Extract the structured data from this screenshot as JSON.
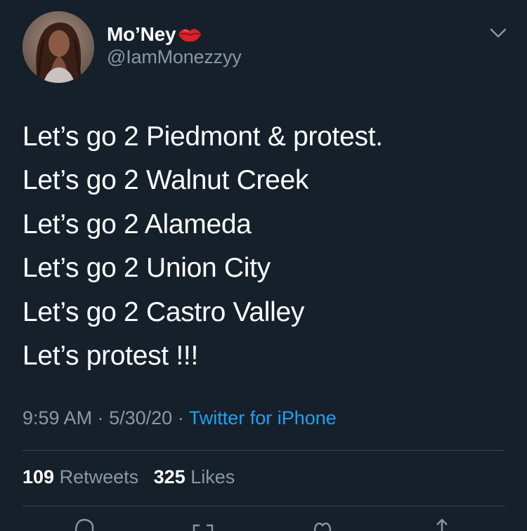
{
  "tweet": {
    "display_name": "Mo’Ney",
    "handle": "@IamMonezzyy",
    "lines": [
      "Let’s go 2 Piedmont & protest.",
      "Let’s go 2 Walnut Creek",
      "Let’s go 2 Alameda",
      "Let’s go 2 Union City",
      "Let’s go 2 Castro Valley",
      "Let’s protest !!!"
    ],
    "time": "9:59 AM",
    "separator": "·",
    "date": "5/30/20",
    "source": "Twitter for iPhone"
  },
  "stats": {
    "retweets_count": "109",
    "retweets_label": "Retweets",
    "likes_count": "325",
    "likes_label": "Likes"
  },
  "icons": {
    "badge": "lips-icon",
    "menu": "chevron-down-icon",
    "actions": [
      "reply-icon",
      "retweet-icon",
      "like-icon",
      "share-icon"
    ]
  },
  "colors": {
    "background": "#15202b",
    "text": "#ffffff",
    "secondary": "#8899a6",
    "link": "#1da1f2",
    "divider": "#38444d",
    "lips": "#d8232a"
  }
}
